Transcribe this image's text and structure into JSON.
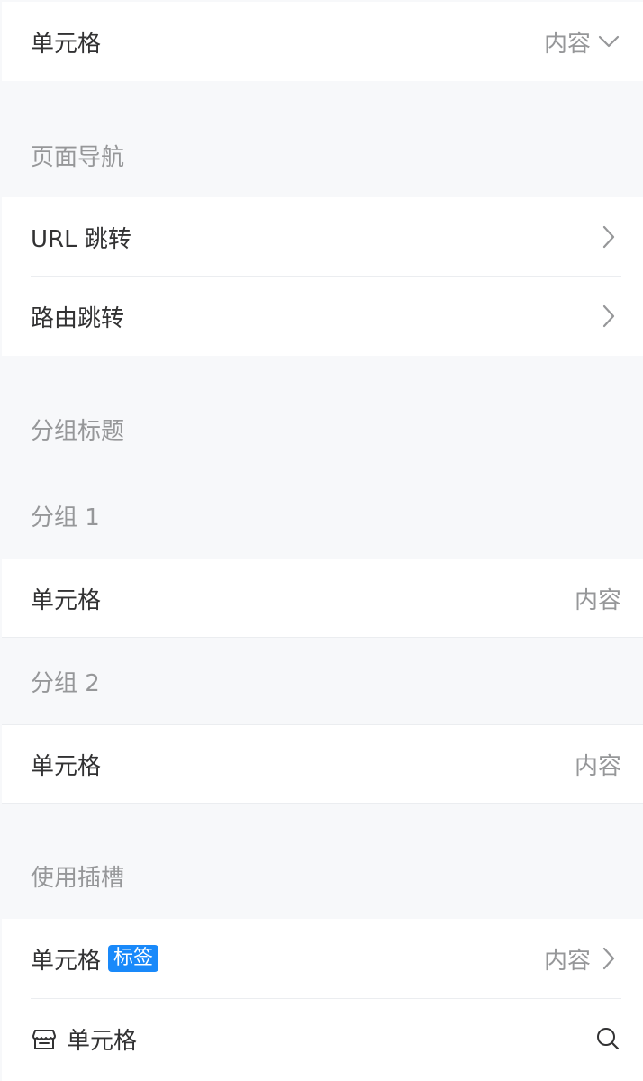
{
  "top_cell": {
    "title": "单元格",
    "value": "内容",
    "icon": "chevron-down-icon"
  },
  "nav_group": {
    "title": "页面导航",
    "items": [
      {
        "title": "URL 跳转",
        "icon": "chevron-right-icon"
      },
      {
        "title": "路由跳转",
        "icon": "chevron-right-icon"
      }
    ]
  },
  "group_title_section": {
    "title": "分组标题",
    "groups": [
      {
        "title": "分组 1",
        "cell": {
          "title": "单元格",
          "value": "内容"
        }
      },
      {
        "title": "分组 2",
        "cell": {
          "title": "单元格",
          "value": "内容"
        }
      }
    ]
  },
  "slot_group": {
    "title": "使用插槽",
    "items": [
      {
        "title": "单元格",
        "tag": "标签",
        "value": "内容",
        "icon": "chevron-right-icon"
      },
      {
        "title": "单元格",
        "left_icon": "shop-icon",
        "right_icon": "search-icon"
      }
    ]
  },
  "colors": {
    "background": "#f7f8fa",
    "text": "#323233",
    "secondary_text": "#969799",
    "tag": "#1989fa"
  }
}
